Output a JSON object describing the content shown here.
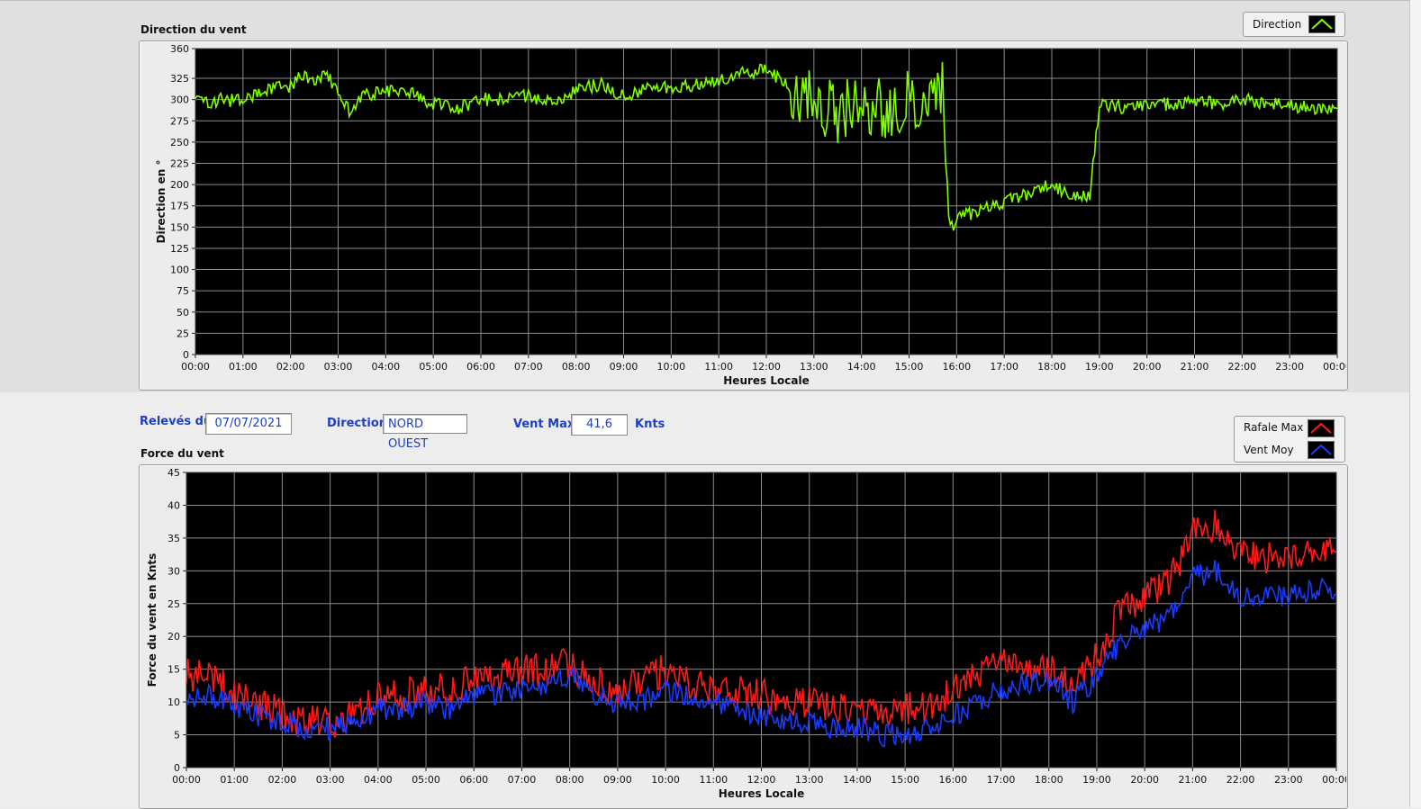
{
  "direction_panel": {
    "title": "Direction du vent",
    "legend_label": "Direction"
  },
  "info": {
    "releves_label": "Relevés du",
    "date": "07/07/2021",
    "direction_label": "Direction",
    "direction_value": "NORD OUEST",
    "ventmax_label": "Vent Max",
    "ventmax_value": "41,6",
    "ventmax_unit": "Knts"
  },
  "force_panel": {
    "title": "Force du vent",
    "legend_gust": "Rafale Max",
    "legend_avg": "Vent Moy"
  },
  "chart_data": [
    {
      "type": "line",
      "title": "Direction du vent",
      "xlabel": "Heures Locale",
      "ylabel": "Direction en °",
      "ylim": [
        0,
        360
      ],
      "yticks": [
        0,
        25,
        50,
        75,
        100,
        125,
        150,
        175,
        200,
        225,
        250,
        275,
        300,
        325,
        360
      ],
      "xticks": [
        "00:00",
        "01:00",
        "02:00",
        "03:00",
        "04:00",
        "05:00",
        "06:00",
        "07:00",
        "08:00",
        "09:00",
        "10:00",
        "11:00",
        "12:00",
        "13:00",
        "14:00",
        "15:00",
        "16:00",
        "17:00",
        "18:00",
        "19:00",
        "20:00",
        "21:00",
        "22:00",
        "23:00",
        "00:00"
      ],
      "grid": true,
      "background": "#000000",
      "series": [
        {
          "name": "Direction",
          "color": "#80ff00",
          "x": [
            0,
            0.25,
            0.5,
            1,
            1.5,
            2,
            2.25,
            2.5,
            2.75,
            3,
            3.25,
            3.5,
            4,
            4.5,
            5,
            5.5,
            6,
            6.5,
            7,
            7.5,
            8,
            8.5,
            9,
            9.5,
            10,
            10.5,
            11,
            11.5,
            12,
            12.5,
            13,
            13.5,
            14,
            14.5,
            15,
            15.5,
            15.7,
            15.85,
            16,
            16.5,
            17,
            17.5,
            18,
            18.5,
            18.8,
            19,
            19.5,
            20,
            20.5,
            21,
            21.5,
            22,
            22.5,
            23,
            23.5,
            24
          ],
          "values": [
            305,
            295,
            300,
            298,
            312,
            315,
            330,
            322,
            330,
            310,
            285,
            305,
            310,
            308,
            295,
            290,
            300,
            300,
            305,
            295,
            310,
            318,
            305,
            312,
            315,
            318,
            322,
            330,
            335,
            315,
            300,
            285,
            295,
            290,
            300,
            300,
            310,
            145,
            160,
            170,
            180,
            190,
            200,
            185,
            185,
            295,
            290,
            292,
            295,
            298,
            295,
            300,
            295,
            292,
            290,
            292
          ]
        }
      ]
    },
    {
      "type": "line",
      "title": "Force du vent",
      "xlabel": "Heures Locale",
      "ylabel": "Force du vent en Knts",
      "ylim": [
        0,
        45
      ],
      "yticks": [
        0,
        5,
        10,
        15,
        20,
        25,
        30,
        35,
        40,
        45
      ],
      "xticks": [
        "00:00",
        "01:00",
        "02:00",
        "03:00",
        "04:00",
        "05:00",
        "06:00",
        "07:00",
        "08:00",
        "09:00",
        "10:00",
        "11:00",
        "12:00",
        "13:00",
        "14:00",
        "15:00",
        "16:00",
        "17:00",
        "18:00",
        "19:00",
        "20:00",
        "21:00",
        "22:00",
        "23:00",
        "00:00"
      ],
      "grid": true,
      "background": "#000000",
      "series": [
        {
          "name": "Rafale Max",
          "color": "#ff1a1a",
          "x": [
            0,
            0.5,
            1,
            1.5,
            2,
            2.5,
            3,
            3.5,
            4,
            4.5,
            5,
            5.5,
            6,
            6.5,
            7,
            7.5,
            8,
            8.5,
            9,
            9.5,
            10,
            10.5,
            11,
            11.5,
            12,
            12.5,
            13,
            13.5,
            14,
            14.5,
            15,
            15.5,
            16,
            16.5,
            17,
            17.5,
            18,
            18.5,
            19,
            19.5,
            20,
            20.5,
            21,
            21.5,
            22,
            22.5,
            23,
            23.5,
            24
          ],
          "values": [
            14,
            14,
            11,
            10,
            8,
            7,
            7,
            8,
            11,
            11,
            12,
            12,
            14,
            14,
            15,
            15,
            16,
            13,
            12,
            13,
            15,
            13,
            12,
            12,
            11,
            10,
            10,
            9,
            9,
            8,
            9,
            9,
            12,
            14,
            16,
            16,
            15,
            13,
            17,
            24,
            26,
            28,
            36,
            37,
            33,
            32,
            32,
            33,
            33
          ]
        },
        {
          "name": "Vent Moy",
          "color": "#1a3aff",
          "x": [
            0,
            0.5,
            1,
            1.5,
            2,
            2.5,
            3,
            3.5,
            4,
            4.5,
            5,
            5.5,
            6,
            6.5,
            7,
            7.5,
            8,
            8.5,
            9,
            9.5,
            10,
            10.5,
            11,
            11.5,
            12,
            12.5,
            13,
            13.5,
            14,
            14.5,
            15,
            15.5,
            16,
            16.5,
            17,
            17.5,
            18,
            18.5,
            19,
            19.5,
            20,
            20.5,
            21,
            21.5,
            22,
            22.5,
            23,
            23.5,
            24
          ],
          "values": [
            11,
            11,
            9,
            8,
            7,
            6,
            6,
            7,
            9,
            9,
            10,
            9,
            11,
            11,
            12,
            12,
            14,
            11,
            10,
            10,
            12,
            11,
            10,
            9,
            8,
            7,
            7,
            6,
            6,
            5,
            5,
            6,
            8,
            10,
            12,
            13,
            13,
            10,
            14,
            19,
            21,
            23,
            29,
            30,
            26,
            26,
            26,
            27,
            27
          ]
        }
      ]
    }
  ]
}
